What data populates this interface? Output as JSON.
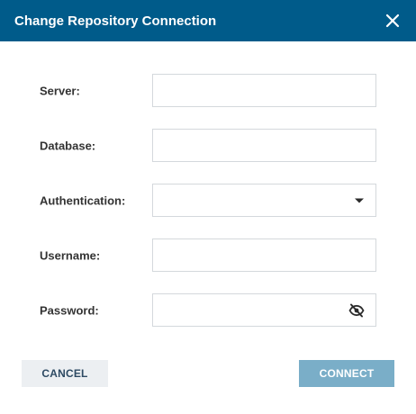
{
  "dialog": {
    "title": "Change Repository Connection",
    "close_icon": "close-icon",
    "header_color": "#005b8a"
  },
  "form": {
    "server": {
      "label": "Server:",
      "value": ""
    },
    "database": {
      "label": "Database:",
      "value": ""
    },
    "authentication": {
      "label": "Authentication:",
      "value": "",
      "icon": "caret-down-icon"
    },
    "username": {
      "label": "Username:",
      "value": ""
    },
    "password": {
      "label": "Password:",
      "value": "",
      "icon": "eye-off-icon"
    }
  },
  "actions": {
    "cancel_label": "CANCEL",
    "connect_label": "CONNECT",
    "connect_color": "#7aaec8"
  }
}
